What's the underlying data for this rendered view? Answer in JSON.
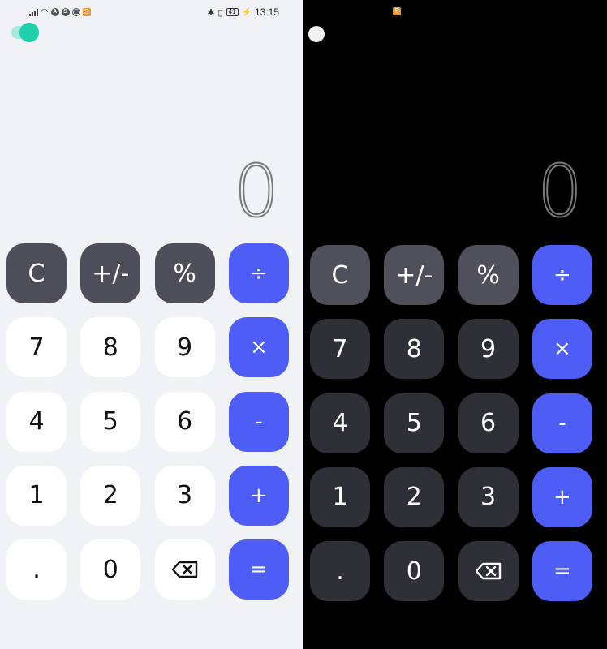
{
  "status_bar": {
    "time": "13:15",
    "battery": "41",
    "app_icon": "S"
  },
  "display": {
    "value": "0"
  },
  "keys": {
    "clear": "C",
    "sign": "+/-",
    "percent": "%",
    "divide": "÷",
    "seven": "7",
    "eight": "8",
    "nine": "9",
    "multiply": "×",
    "four": "4",
    "five": "5",
    "six": "6",
    "minus": "-",
    "one": "1",
    "two": "2",
    "three": "3",
    "plus": "+",
    "decimal": ".",
    "zero": "0",
    "equals": "="
  },
  "colors": {
    "light_bg": "#f1f2f6",
    "dark_bg": "#000000",
    "accent": "#4d5df5",
    "toggle_on": "#1fcfad",
    "light_fn_key": "#4d4e5a",
    "dark_num_key": "#2e2f37"
  },
  "icons": {
    "backspace": "backspace-icon",
    "theme_toggle": "toggle-icon"
  }
}
